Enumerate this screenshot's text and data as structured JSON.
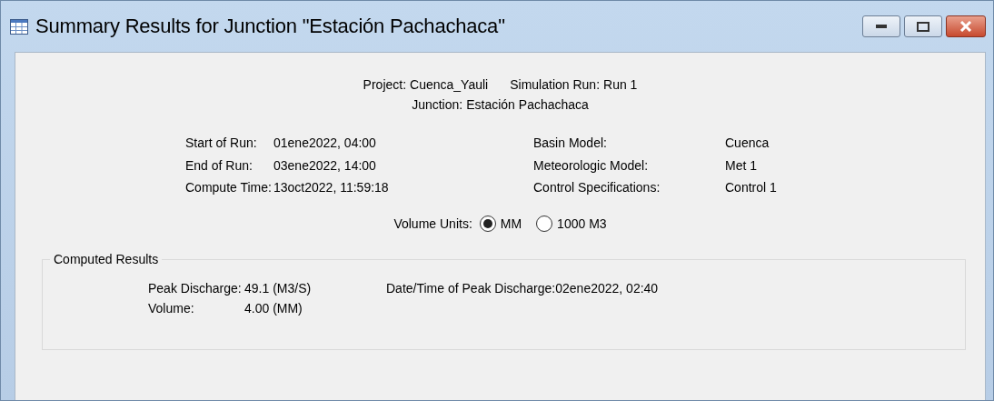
{
  "window": {
    "title": "Summary Results for Junction \"Estación Pachachaca\""
  },
  "header": [
    {
      "label": "Project:",
      "value": "Cuenca_Yauli"
    },
    {
      "label": "Simulation Run:",
      "value": "Run 1"
    },
    {
      "label": "Junction:",
      "value": "Estación Pachachaca"
    }
  ],
  "run_info": {
    "left": [
      {
        "label": "Start of Run:",
        "value": "01ene2022, 04:00"
      },
      {
        "label": "End of Run:",
        "value": "03ene2022, 14:00"
      },
      {
        "label": "Compute Time:",
        "value": "13oct2022, 11:59:18"
      }
    ],
    "right": [
      {
        "label": "Basin Model:",
        "value": "Cuenca"
      },
      {
        "label": "Meteorologic Model:",
        "value": "Met 1"
      },
      {
        "label": "Control Specifications:",
        "value": "Control 1"
      }
    ]
  },
  "volume_units": {
    "label": "Volume Units:",
    "options": [
      {
        "label": "MM",
        "selected": true
      },
      {
        "label": "1000 M3",
        "selected": false
      }
    ]
  },
  "computed_results": {
    "title": "Computed Results",
    "left": [
      {
        "label": "Peak Discharge:",
        "value": "49.1 (M3/S)"
      },
      {
        "label": "Volume:",
        "value": "4.00 (MM)"
      }
    ],
    "right": [
      {
        "label": "Date/Time of Peak Discharge:",
        "value": "02ene2022, 02:40"
      }
    ]
  }
}
